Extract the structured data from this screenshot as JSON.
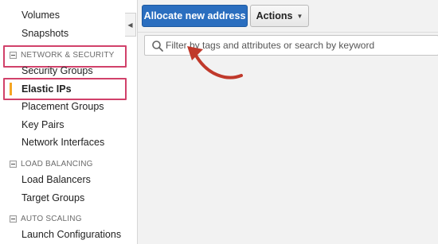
{
  "sidebar": {
    "items_top": [
      {
        "label": "Volumes"
      },
      {
        "label": "Snapshots"
      }
    ],
    "sections": [
      {
        "title": "NETWORK & SECURITY",
        "items": [
          {
            "label": "Security Groups"
          },
          {
            "label": "Elastic IPs",
            "active": true
          },
          {
            "label": "Placement Groups"
          },
          {
            "label": "Key Pairs"
          },
          {
            "label": "Network Interfaces"
          }
        ]
      },
      {
        "title": "LOAD BALANCING",
        "items": [
          {
            "label": "Load Balancers"
          },
          {
            "label": "Target Groups"
          }
        ]
      },
      {
        "title": "AUTO SCALING",
        "items": [
          {
            "label": "Launch Configurations"
          }
        ]
      }
    ]
  },
  "toolbar": {
    "allocate_label": "Allocate new address",
    "actions_label": "Actions"
  },
  "search": {
    "placeholder": "Filter by tags and attributes or search by keyword"
  },
  "colors": {
    "primary_button": "#2a6ebf",
    "highlight": "#d1416a",
    "active_marker": "#f5a623",
    "annotation_arrow": "#c0392b"
  }
}
